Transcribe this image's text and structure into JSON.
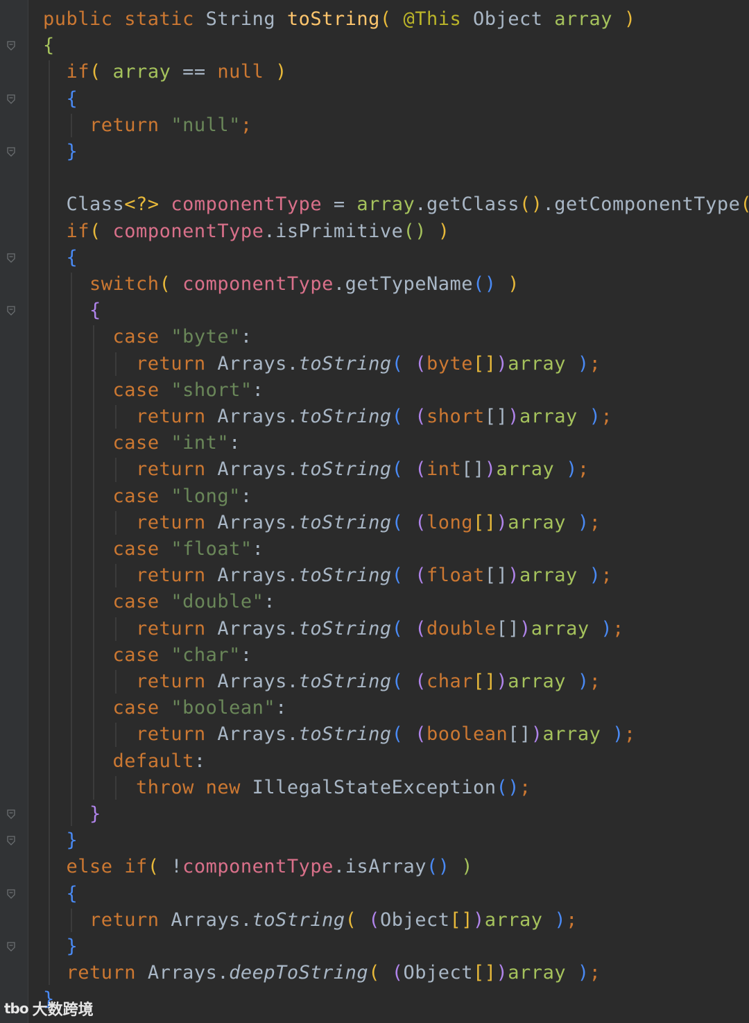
{
  "editor": {
    "language": "Java",
    "colors": {
      "background": "#2b2b2b",
      "keyword": "#cc7832",
      "string": "#6a8759",
      "method": "#ffc66d",
      "annotation": "#bbb529",
      "parameter": "#a5c25c",
      "field": "#d9708a",
      "identifier": "#a9b7c6",
      "paren_outer": "#e8b93a",
      "paren_inner": "#4a8af4",
      "paren_third": "#b084eb"
    },
    "lines": [
      [
        {
          "t": "public static ",
          "c": "keyword"
        },
        {
          "t": "String ",
          "c": "identifier"
        },
        {
          "t": "toString",
          "c": "method"
        },
        {
          "t": "( ",
          "c": "paren_outer"
        },
        {
          "t": "@This ",
          "c": "annotation"
        },
        {
          "t": "Object ",
          "c": "identifier"
        },
        {
          "t": "array ",
          "c": "parameter"
        },
        {
          "t": ")",
          "c": "paren_outer"
        }
      ],
      [
        {
          "t": "{",
          "c": "parameter"
        }
      ],
      [
        {
          "t": "  "
        },
        {
          "t": "if",
          "c": "keyword"
        },
        {
          "t": "( ",
          "c": "paren_outer"
        },
        {
          "t": "array ",
          "c": "parameter"
        },
        {
          "t": "== ",
          "c": "identifier"
        },
        {
          "t": "null ",
          "c": "keyword"
        },
        {
          "t": ")",
          "c": "paren_outer"
        }
      ],
      [
        {
          "t": "  "
        },
        {
          "t": "{",
          "c": "paren_inner"
        }
      ],
      [
        {
          "t": "    "
        },
        {
          "t": "return ",
          "c": "keyword"
        },
        {
          "t": "\"null\"",
          "c": "string"
        },
        {
          "t": ";",
          "c": "keyword"
        }
      ],
      [
        {
          "t": "  "
        },
        {
          "t": "}",
          "c": "paren_inner"
        }
      ],
      [],
      [
        {
          "t": "  "
        },
        {
          "t": "Class",
          "c": "identifier"
        },
        {
          "t": "<?> ",
          "c": "paren_outer"
        },
        {
          "t": "componentType ",
          "c": "field"
        },
        {
          "t": "= ",
          "c": "identifier"
        },
        {
          "t": "array",
          "c": "parameter"
        },
        {
          "t": ".getClass",
          "c": "identifier"
        },
        {
          "t": "()",
          "c": "paren_outer"
        },
        {
          "t": ".getComponentType",
          "c": "identifier"
        },
        {
          "t": "()",
          "c": "paren_outer"
        },
        {
          "t": ";",
          "c": "keyword"
        }
      ],
      [
        {
          "t": "  "
        },
        {
          "t": "if",
          "c": "keyword"
        },
        {
          "t": "( ",
          "c": "paren_outer"
        },
        {
          "t": "componentType",
          "c": "field"
        },
        {
          "t": ".isPrimitive",
          "c": "identifier"
        },
        {
          "t": "() ",
          "c": "parameter"
        },
        {
          "t": ")",
          "c": "paren_outer"
        }
      ],
      [
        {
          "t": "  "
        },
        {
          "t": "{",
          "c": "paren_inner"
        }
      ],
      [
        {
          "t": "    "
        },
        {
          "t": "switch",
          "c": "keyword"
        },
        {
          "t": "( ",
          "c": "paren_outer"
        },
        {
          "t": "componentType",
          "c": "field"
        },
        {
          "t": ".getTypeName",
          "c": "identifier"
        },
        {
          "t": "() ",
          "c": "paren_inner"
        },
        {
          "t": ")",
          "c": "paren_outer"
        }
      ],
      [
        {
          "t": "    "
        },
        {
          "t": "{",
          "c": "paren_third"
        }
      ],
      [
        {
          "t": "      "
        },
        {
          "t": "case ",
          "c": "keyword"
        },
        {
          "t": "\"byte\"",
          "c": "string"
        },
        {
          "t": ":",
          "c": "identifier"
        }
      ],
      [
        {
          "t": "        "
        },
        {
          "t": "return ",
          "c": "keyword"
        },
        {
          "t": "Arrays.",
          "c": "identifier"
        },
        {
          "t": "toString",
          "c": "identifier",
          "i": true
        },
        {
          "t": "( ",
          "c": "paren_inner"
        },
        {
          "t": "(",
          "c": "paren_third"
        },
        {
          "t": "byte",
          "c": "keyword"
        },
        {
          "t": "[]",
          "c": "paren_outer"
        },
        {
          "t": ")",
          "c": "paren_third"
        },
        {
          "t": "array ",
          "c": "parameter"
        },
        {
          "t": ")",
          "c": "paren_inner"
        },
        {
          "t": ";",
          "c": "keyword"
        }
      ],
      [
        {
          "t": "      "
        },
        {
          "t": "case ",
          "c": "keyword"
        },
        {
          "t": "\"short\"",
          "c": "string"
        },
        {
          "t": ":",
          "c": "identifier"
        }
      ],
      [
        {
          "t": "        "
        },
        {
          "t": "return ",
          "c": "keyword"
        },
        {
          "t": "Arrays.",
          "c": "identifier"
        },
        {
          "t": "toString",
          "c": "identifier",
          "i": true
        },
        {
          "t": "( ",
          "c": "paren_inner"
        },
        {
          "t": "(",
          "c": "paren_third"
        },
        {
          "t": "short",
          "c": "keyword"
        },
        {
          "t": "[]",
          "c": "identifier"
        },
        {
          "t": ")",
          "c": "paren_third"
        },
        {
          "t": "array ",
          "c": "parameter"
        },
        {
          "t": ")",
          "c": "paren_inner"
        },
        {
          "t": ";",
          "c": "keyword"
        }
      ],
      [
        {
          "t": "      "
        },
        {
          "t": "case ",
          "c": "keyword"
        },
        {
          "t": "\"int\"",
          "c": "string"
        },
        {
          "t": ":",
          "c": "identifier"
        }
      ],
      [
        {
          "t": "        "
        },
        {
          "t": "return ",
          "c": "keyword"
        },
        {
          "t": "Arrays.",
          "c": "identifier"
        },
        {
          "t": "toString",
          "c": "identifier",
          "i": true
        },
        {
          "t": "( ",
          "c": "paren_inner"
        },
        {
          "t": "(",
          "c": "paren_third"
        },
        {
          "t": "int",
          "c": "keyword"
        },
        {
          "t": "[]",
          "c": "identifier"
        },
        {
          "t": ")",
          "c": "paren_third"
        },
        {
          "t": "array ",
          "c": "parameter"
        },
        {
          "t": ")",
          "c": "paren_inner"
        },
        {
          "t": ";",
          "c": "keyword"
        }
      ],
      [
        {
          "t": "      "
        },
        {
          "t": "case ",
          "c": "keyword"
        },
        {
          "t": "\"long\"",
          "c": "string"
        },
        {
          "t": ":",
          "c": "identifier"
        }
      ],
      [
        {
          "t": "        "
        },
        {
          "t": "return ",
          "c": "keyword"
        },
        {
          "t": "Arrays.",
          "c": "identifier"
        },
        {
          "t": "toString",
          "c": "identifier",
          "i": true
        },
        {
          "t": "( ",
          "c": "paren_inner"
        },
        {
          "t": "(",
          "c": "paren_third"
        },
        {
          "t": "long",
          "c": "keyword"
        },
        {
          "t": "[]",
          "c": "paren_outer"
        },
        {
          "t": ")",
          "c": "paren_third"
        },
        {
          "t": "array ",
          "c": "parameter"
        },
        {
          "t": ")",
          "c": "paren_inner"
        },
        {
          "t": ";",
          "c": "keyword"
        }
      ],
      [
        {
          "t": "      "
        },
        {
          "t": "case ",
          "c": "keyword"
        },
        {
          "t": "\"float\"",
          "c": "string"
        },
        {
          "t": ":",
          "c": "identifier"
        }
      ],
      [
        {
          "t": "        "
        },
        {
          "t": "return ",
          "c": "keyword"
        },
        {
          "t": "Arrays.",
          "c": "identifier"
        },
        {
          "t": "toString",
          "c": "identifier",
          "i": true
        },
        {
          "t": "( ",
          "c": "paren_inner"
        },
        {
          "t": "(",
          "c": "paren_third"
        },
        {
          "t": "float",
          "c": "keyword"
        },
        {
          "t": "[]",
          "c": "identifier"
        },
        {
          "t": ")",
          "c": "paren_third"
        },
        {
          "t": "array ",
          "c": "parameter"
        },
        {
          "t": ")",
          "c": "paren_inner"
        },
        {
          "t": ";",
          "c": "keyword"
        }
      ],
      [
        {
          "t": "      "
        },
        {
          "t": "case ",
          "c": "keyword"
        },
        {
          "t": "\"double\"",
          "c": "string"
        },
        {
          "t": ":",
          "c": "identifier"
        }
      ],
      [
        {
          "t": "        "
        },
        {
          "t": "return ",
          "c": "keyword"
        },
        {
          "t": "Arrays.",
          "c": "identifier"
        },
        {
          "t": "toString",
          "c": "identifier",
          "i": true
        },
        {
          "t": "( ",
          "c": "paren_inner"
        },
        {
          "t": "(",
          "c": "paren_third"
        },
        {
          "t": "double",
          "c": "keyword"
        },
        {
          "t": "[]",
          "c": "identifier"
        },
        {
          "t": ")",
          "c": "paren_third"
        },
        {
          "t": "array ",
          "c": "parameter"
        },
        {
          "t": ")",
          "c": "paren_inner"
        },
        {
          "t": ";",
          "c": "keyword"
        }
      ],
      [
        {
          "t": "      "
        },
        {
          "t": "case ",
          "c": "keyword"
        },
        {
          "t": "\"char\"",
          "c": "string"
        },
        {
          "t": ":",
          "c": "identifier"
        }
      ],
      [
        {
          "t": "        "
        },
        {
          "t": "return ",
          "c": "keyword"
        },
        {
          "t": "Arrays.",
          "c": "identifier"
        },
        {
          "t": "toString",
          "c": "identifier",
          "i": true
        },
        {
          "t": "( ",
          "c": "paren_inner"
        },
        {
          "t": "(",
          "c": "paren_third"
        },
        {
          "t": "char",
          "c": "keyword"
        },
        {
          "t": "[]",
          "c": "paren_outer"
        },
        {
          "t": ")",
          "c": "paren_third"
        },
        {
          "t": "array ",
          "c": "parameter"
        },
        {
          "t": ")",
          "c": "paren_inner"
        },
        {
          "t": ";",
          "c": "keyword"
        }
      ],
      [
        {
          "t": "      "
        },
        {
          "t": "case ",
          "c": "keyword"
        },
        {
          "t": "\"boolean\"",
          "c": "string"
        },
        {
          "t": ":",
          "c": "identifier"
        }
      ],
      [
        {
          "t": "        "
        },
        {
          "t": "return ",
          "c": "keyword"
        },
        {
          "t": "Arrays.",
          "c": "identifier"
        },
        {
          "t": "toString",
          "c": "identifier",
          "i": true
        },
        {
          "t": "( ",
          "c": "paren_inner"
        },
        {
          "t": "(",
          "c": "paren_third"
        },
        {
          "t": "boolean",
          "c": "keyword"
        },
        {
          "t": "[]",
          "c": "identifier"
        },
        {
          "t": ")",
          "c": "paren_third"
        },
        {
          "t": "array ",
          "c": "parameter"
        },
        {
          "t": ")",
          "c": "paren_inner"
        },
        {
          "t": ";",
          "c": "keyword"
        }
      ],
      [
        {
          "t": "      "
        },
        {
          "t": "default",
          "c": "keyword"
        },
        {
          "t": ":",
          "c": "identifier"
        }
      ],
      [
        {
          "t": "        "
        },
        {
          "t": "throw new ",
          "c": "keyword"
        },
        {
          "t": "IllegalStateException",
          "c": "identifier"
        },
        {
          "t": "()",
          "c": "paren_inner"
        },
        {
          "t": ";",
          "c": "keyword"
        }
      ],
      [
        {
          "t": "    "
        },
        {
          "t": "}",
          "c": "paren_third"
        }
      ],
      [
        {
          "t": "  "
        },
        {
          "t": "}",
          "c": "paren_inner"
        }
      ],
      [
        {
          "t": "  "
        },
        {
          "t": "else if",
          "c": "keyword"
        },
        {
          "t": "( ",
          "c": "paren_outer"
        },
        {
          "t": "!",
          "c": "identifier"
        },
        {
          "t": "componentType",
          "c": "field"
        },
        {
          "t": ".isArray",
          "c": "identifier"
        },
        {
          "t": "() ",
          "c": "paren_inner"
        },
        {
          "t": ")",
          "c": "parameter"
        }
      ],
      [
        {
          "t": "  "
        },
        {
          "t": "{",
          "c": "paren_inner"
        }
      ],
      [
        {
          "t": "    "
        },
        {
          "t": "return ",
          "c": "keyword"
        },
        {
          "t": "Arrays.",
          "c": "identifier"
        },
        {
          "t": "toString",
          "c": "identifier",
          "i": true
        },
        {
          "t": "( ",
          "c": "paren_outer"
        },
        {
          "t": "(",
          "c": "paren_third"
        },
        {
          "t": "Object",
          "c": "identifier"
        },
        {
          "t": "[]",
          "c": "paren_outer"
        },
        {
          "t": ")",
          "c": "paren_third"
        },
        {
          "t": "array ",
          "c": "parameter"
        },
        {
          "t": ")",
          "c": "paren_inner"
        },
        {
          "t": ";",
          "c": "keyword"
        }
      ],
      [
        {
          "t": "  "
        },
        {
          "t": "}",
          "c": "paren_inner"
        }
      ],
      [
        {
          "t": "  "
        },
        {
          "t": "return ",
          "c": "keyword"
        },
        {
          "t": "Arrays.",
          "c": "identifier"
        },
        {
          "t": "deepToString",
          "c": "identifier",
          "i": true
        },
        {
          "t": "( ",
          "c": "paren_outer"
        },
        {
          "t": "(",
          "c": "paren_third"
        },
        {
          "t": "Object",
          "c": "identifier"
        },
        {
          "t": "[]",
          "c": "paren_outer"
        },
        {
          "t": ")",
          "c": "paren_third"
        },
        {
          "t": "array ",
          "c": "parameter"
        },
        {
          "t": ")",
          "c": "paren_inner"
        },
        {
          "t": ";",
          "c": "keyword"
        }
      ],
      [
        {
          "t": "}",
          "c": "paren_inner"
        }
      ]
    ],
    "fold_markers": [
      1,
      3,
      5,
      9,
      11,
      30,
      31,
      33,
      35
    ]
  },
  "watermark": {
    "logo_text": "tbo",
    "text": "大数跨境"
  }
}
